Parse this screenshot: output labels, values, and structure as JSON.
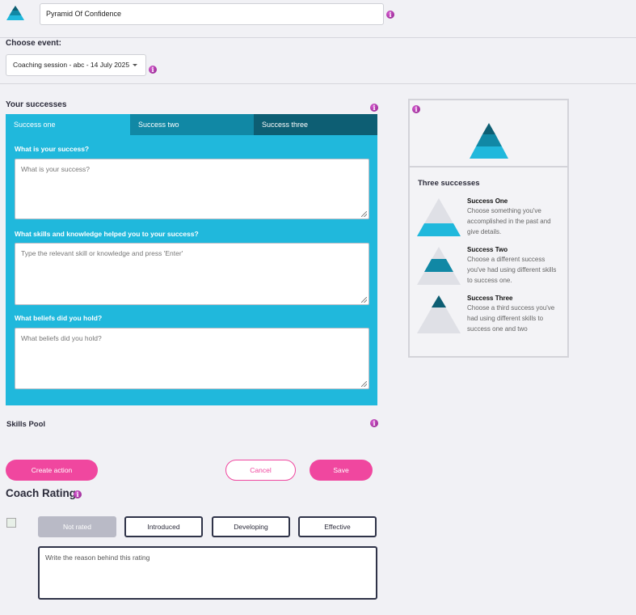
{
  "header": {
    "title_value": "Pyramid Of Confidence"
  },
  "event": {
    "label": "Choose event:",
    "selected": "Coaching session - abc - 14 July 2025"
  },
  "successes": {
    "heading": "Your successes",
    "tabs": [
      "Success one",
      "Success two",
      "Success three"
    ],
    "questions": [
      {
        "label": "What is your success?",
        "placeholder": "What is your success?"
      },
      {
        "label": "What skills and knowledge helped you to your success?",
        "placeholder": "Type the relevant skill or knowledge and press 'Enter'"
      },
      {
        "label": "What beliefs did you hold?",
        "placeholder": "What beliefs did you hold?"
      }
    ]
  },
  "skills_pool": {
    "label": "Skills Pool"
  },
  "buttons": {
    "create_action": "Create action",
    "cancel": "Cancel",
    "save": "Save"
  },
  "side": {
    "title": "Three successes",
    "items": [
      {
        "title": "Success One",
        "desc": "Choose something you've accomplished in the past and give details."
      },
      {
        "title": "Success Two",
        "desc": "Choose a different success you've had using different skills to success one."
      },
      {
        "title": "Success Three",
        "desc": "Choose a third success you've had using different skills to success one and two"
      }
    ]
  },
  "coach": {
    "title": "Coach Rating",
    "options": [
      "Not rated",
      "Introduced",
      "Developing",
      "Effective"
    ],
    "selected": "Not rated",
    "reason_placeholder": "Write the reason behind this rating"
  },
  "colors": {
    "accent": "#20b8dc",
    "tab2": "#1188a5",
    "tab3": "#0d5e73",
    "pink": "#f0479f",
    "info": "#a62ba1"
  }
}
